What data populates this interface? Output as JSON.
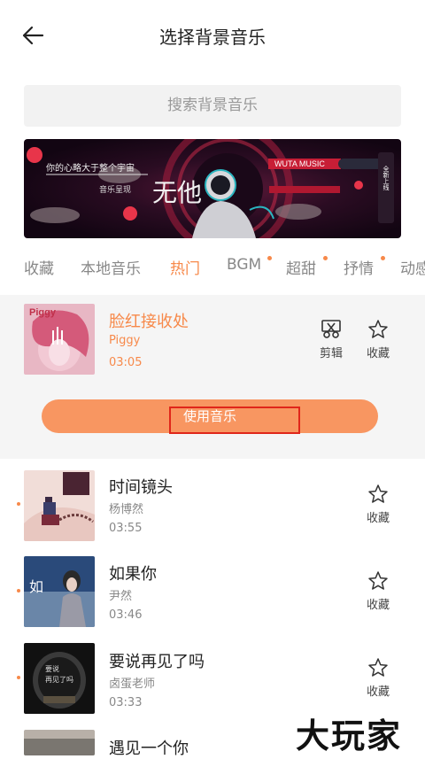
{
  "header": {
    "title": "选择背景音乐"
  },
  "search": {
    "placeholder": "搜索背景音乐"
  },
  "banner": {
    "brand": "WUTA MUSIC",
    "line1": "你的心略大于整个宇宙",
    "line2": "音乐呈现",
    "big_text": "无他",
    "vertical_text": "全新上线"
  },
  "tabs": [
    {
      "label": "收藏",
      "dot": false,
      "active": false
    },
    {
      "label": "本地音乐",
      "dot": false,
      "active": false
    },
    {
      "label": "热门",
      "dot": false,
      "active": true
    },
    {
      "label": "BGM",
      "dot": true,
      "active": false
    },
    {
      "label": "超甜",
      "dot": true,
      "active": false
    },
    {
      "label": "抒情",
      "dot": true,
      "active": false
    },
    {
      "label": "动感",
      "dot": false,
      "active": false
    }
  ],
  "selected_song": {
    "title": "脸红接收处",
    "artist": "Piggy",
    "duration": "03:05",
    "cover_text": "Piggy",
    "edit_label": "剪辑",
    "fav_label": "收藏",
    "use_label": "使用音乐"
  },
  "songs": [
    {
      "title": "时间镜头",
      "artist": "杨博然",
      "duration": "03:55",
      "fav_label": "收藏"
    },
    {
      "title": "如果你",
      "artist": "尹然",
      "duration": "03:46",
      "fav_label": "收藏"
    },
    {
      "title": "要说再见了吗",
      "artist": "卤蛋老师",
      "duration": "03:33",
      "fav_label": "收藏"
    },
    {
      "title": "遇见一个你",
      "artist": "",
      "duration": "",
      "fav_label": ""
    }
  ],
  "watermark": "大玩家",
  "colors": {
    "accent": "#f7894a",
    "button": "#f89661",
    "highlight_box": "#e0261a"
  }
}
